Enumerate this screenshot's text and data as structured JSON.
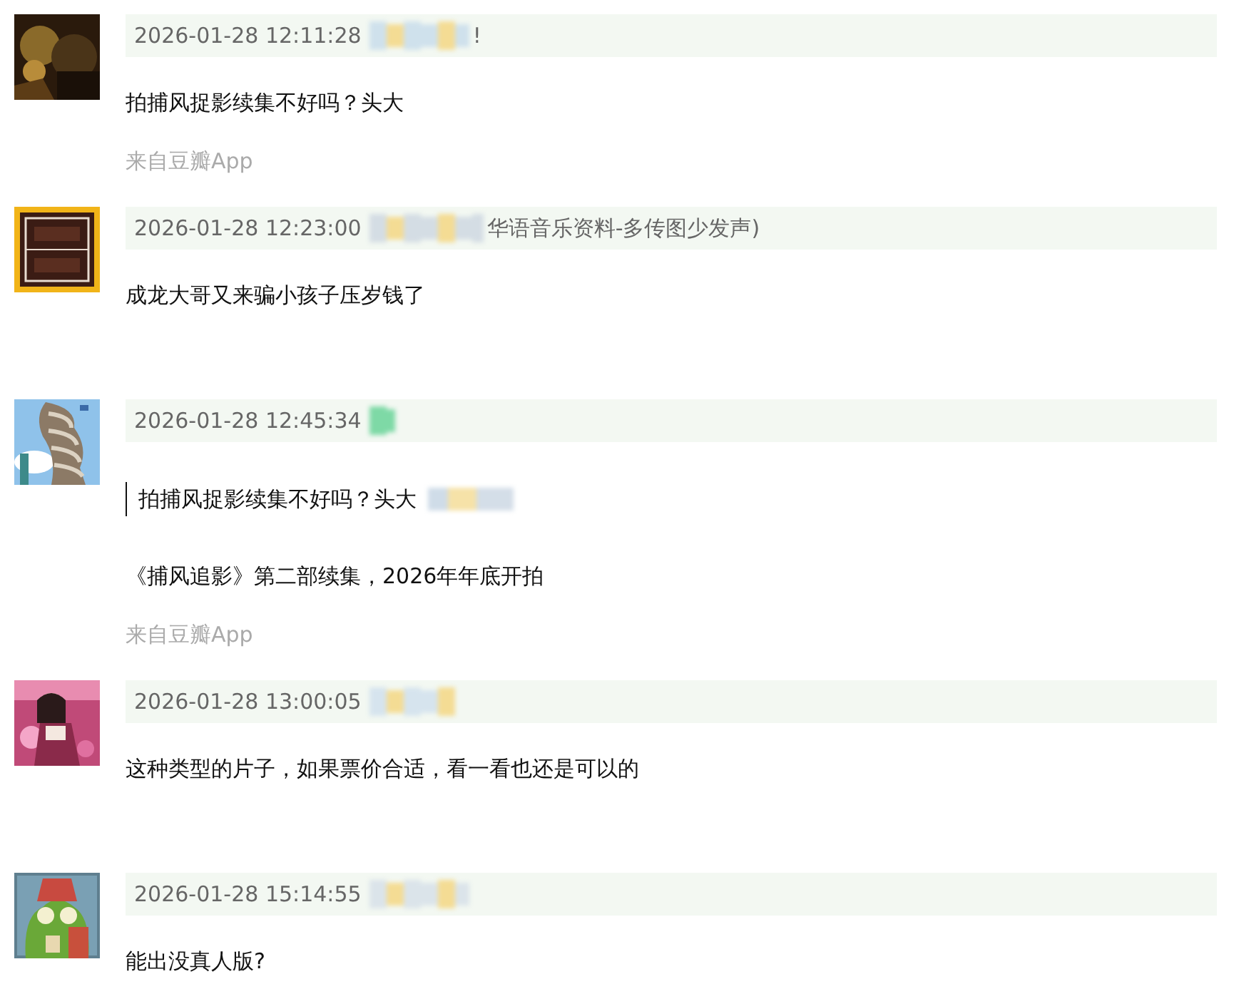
{
  "comments": [
    {
      "time": "2026-01-28 12:11:28",
      "name_tail": "!",
      "text": "拍捕风捉影续集不好吗？头大",
      "source": "来自豆瓣App"
    },
    {
      "time": "2026-01-28 12:23:00",
      "name_tail": "华语音乐资料-多传图少发声)",
      "text": "成龙大哥又来骗小孩子压岁钱了"
    },
    {
      "time": "2026-01-28 12:45:34",
      "quote": "拍捕风捉影续集不好吗？头大",
      "text": "《捕风追影》第二部续集，2026年年底开拍",
      "source": "来自豆瓣App"
    },
    {
      "time": "2026-01-28 13:00:05",
      "text": "这种类型的片子，如果票价合适，看一看也还是可以的"
    },
    {
      "time": "2026-01-28 15:14:55",
      "text": "能出没真人版?"
    }
  ]
}
